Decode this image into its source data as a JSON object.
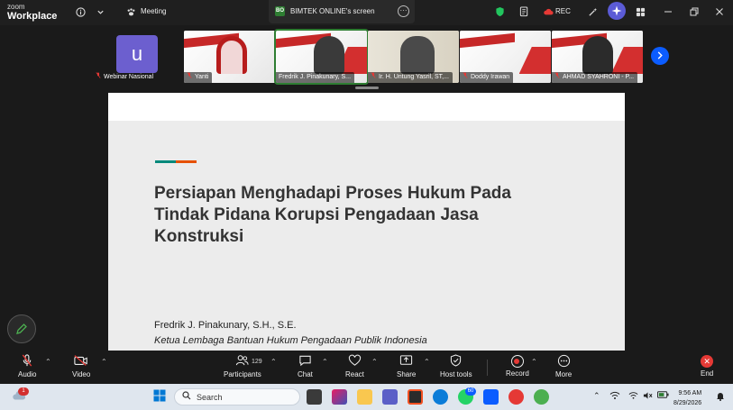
{
  "app": {
    "brand_line1": "zoom",
    "brand_line2": "Workplace",
    "meeting_label": "Meeting",
    "screen_share_label": "BIMTEK ONLINE's screen",
    "screen_share_badge": "BO",
    "recording_label": "REC"
  },
  "participants_strip": [
    {
      "name": "Webinar Nasional",
      "avatar_letter": "u",
      "muted": true
    },
    {
      "name": "Yanti",
      "muted": true
    },
    {
      "name": "Fredrik J. Pinakunary, S...",
      "muted": false,
      "active_speaker": true
    },
    {
      "name": "Ir. H. Untung Yasril, ST,...",
      "muted": true
    },
    {
      "name": "Doddy Irawan",
      "muted": true
    },
    {
      "name": "AHMAD SYAHRONI - P...",
      "muted": true
    }
  ],
  "slide": {
    "title": "Persiapan Menghadapi Proses Hukum Pada Tindak Pidana Korupsi Pengadaan Jasa Konstruksi",
    "presenter": "Fredrik J. Pinakunary, S.H., S.E.",
    "presenter_role": "Ketua Lembaga Bantuan Hukum Pengadaan Publik Indonesia"
  },
  "toolbar": {
    "audio": "Audio",
    "video": "Video",
    "participants": "Participants",
    "participants_count": "129",
    "chat": "Chat",
    "react": "React",
    "share": "Share",
    "host_tools": "Host tools",
    "record": "Record",
    "more": "More",
    "end": "End"
  },
  "taskbar": {
    "search_placeholder": "Search",
    "weather_badge": "1",
    "whatsapp_badge": "60",
    "time": "9:56 AM",
    "date": "8/29/2026"
  },
  "colors": {
    "accent_blue": "#0b5cff",
    "active_speaker": "#2e7d32",
    "end_red": "#e53935",
    "avatar_purple": "#6c5fcf"
  }
}
